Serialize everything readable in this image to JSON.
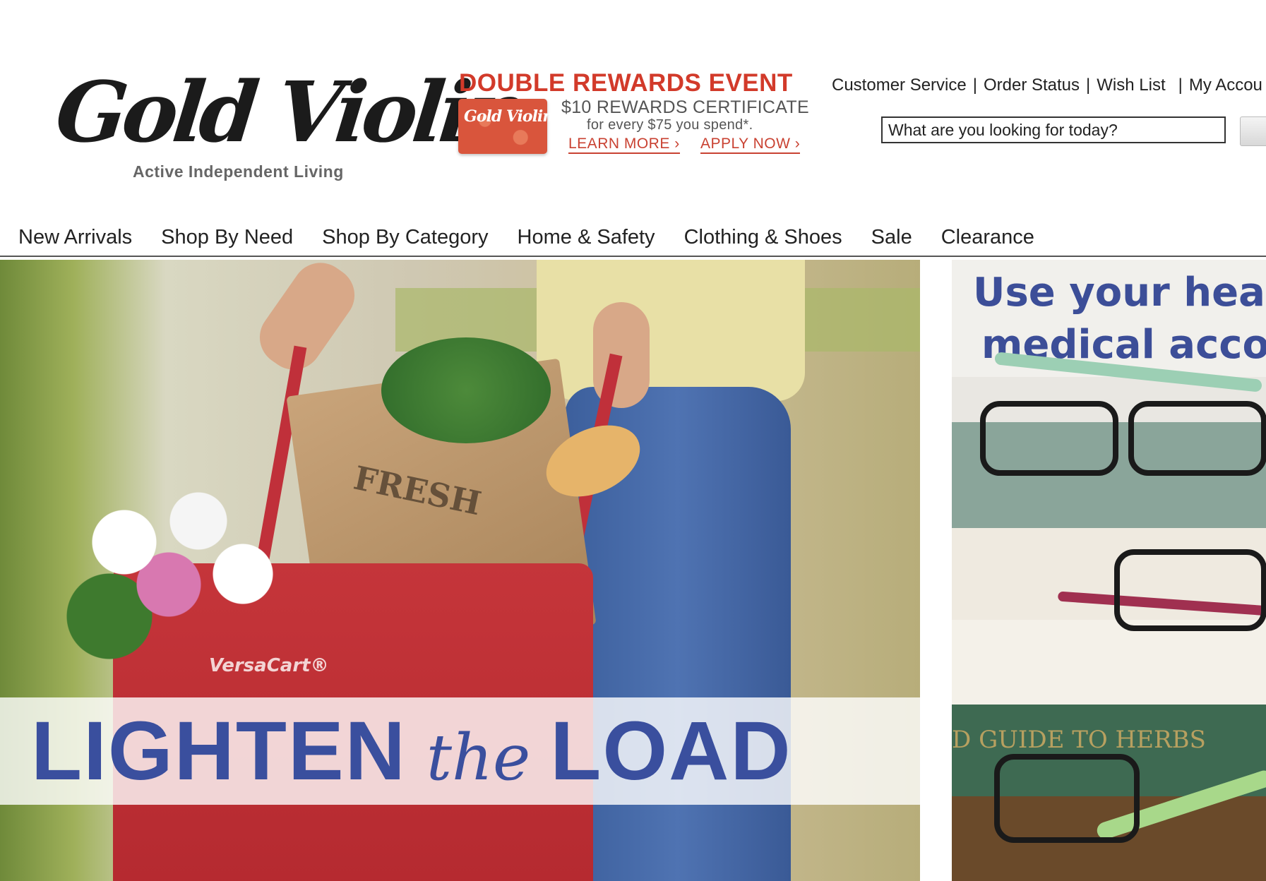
{
  "brand": {
    "name": "Gold Violin",
    "tagline": "Active Independent Living"
  },
  "promo": {
    "title": "DOUBLE REWARDS EVENT",
    "card_logo": "Gold Violin",
    "certificate": "$10 REWARDS CERTIFICATE",
    "subline": "for every $75 you spend*.",
    "learn_more": "LEARN MORE ›",
    "apply_now": "APPLY NOW ›",
    "accent_color": "#d23a2a"
  },
  "utility_nav": {
    "customer_service": "Customer Service",
    "order_status": "Order Status",
    "wish_list": "Wish List",
    "my_account": "My Accou",
    "separator": "|"
  },
  "search": {
    "placeholder": "What are you looking for today?"
  },
  "main_nav": [
    "New Arrivals",
    "Shop By Need",
    "Shop By Category",
    "Home & Safety",
    "Clothing & Shoes",
    "Sale",
    "Clearance"
  ],
  "hero_left": {
    "product_brand": "VersaCart®",
    "bag_text": "FRESH",
    "headline_1": "LIGHTEN",
    "headline_2": "the",
    "headline_3": "LOAD",
    "headline_color": "#3a4f9e"
  },
  "hero_right": {
    "line_1": "Use your hea",
    "line_2": "medical acco",
    "book_title": "D GUIDE TO HERBS",
    "headline_color": "#3c4e98"
  }
}
